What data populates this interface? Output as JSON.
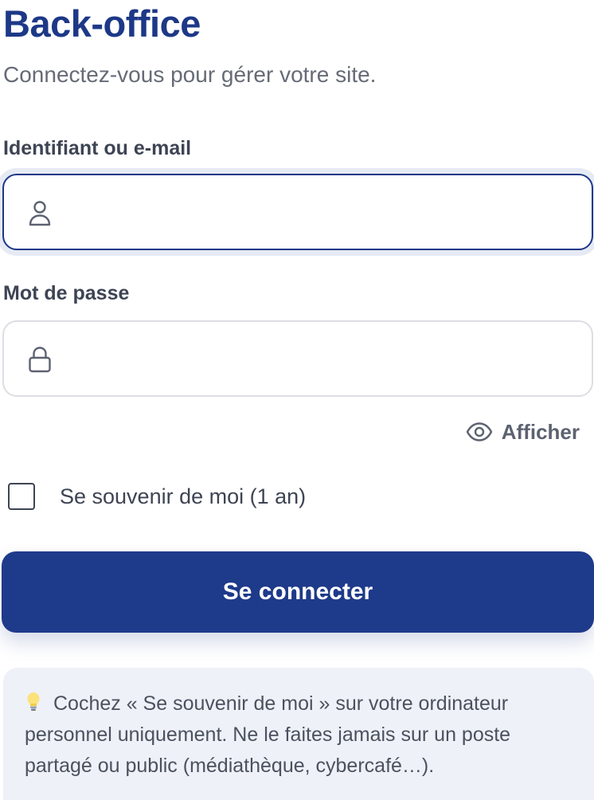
{
  "header": {
    "title": "Back-office",
    "subtitle": "Connectez-vous pour gérer votre site."
  },
  "form": {
    "username": {
      "label": "Identifiant ou e-mail",
      "value": "",
      "icon": "user-icon"
    },
    "password": {
      "label": "Mot de passe",
      "value": "",
      "icon": "lock-icon"
    },
    "show_password": {
      "label": "Afficher",
      "icon": "eye-icon"
    },
    "remember": {
      "label": "Se souvenir de moi (1 an)",
      "checked": false
    },
    "submit_label": "Se connecter"
  },
  "tip": {
    "icon": "lightbulb-icon",
    "text": "Cochez « Se souvenir de moi » sur votre ordinateur personnel uniquement. Ne le faites jamais sur un poste partagé ou public (médiathèque, cybercafé…)."
  },
  "colors": {
    "brand": "#1e3a8a",
    "text": "#3d4453",
    "muted": "#666b76",
    "tip_background": "#eef1f7"
  }
}
